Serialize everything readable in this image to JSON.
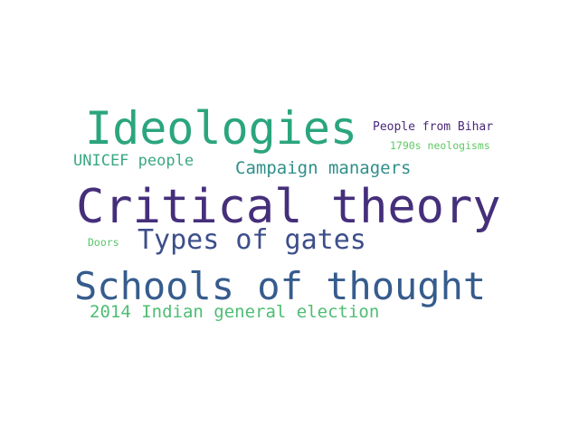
{
  "words": [
    {
      "text": "Critical theory",
      "color": "#452f7b"
    },
    {
      "text": "Ideologies",
      "color": "#2ba57e"
    },
    {
      "text": "Schools of thought",
      "color": "#365c8d"
    },
    {
      "text": "Types of gates",
      "color": "#3d4e8a"
    },
    {
      "text": "Campaign managers",
      "color": "#2f8f8a"
    },
    {
      "text": "UNICEF people",
      "color": "#3aa882"
    },
    {
      "text": "2014 Indian general election",
      "color": "#4fbd73"
    },
    {
      "text": "People from Bihar",
      "color": "#482878"
    },
    {
      "text": "1790s neologisms",
      "color": "#5ec962"
    },
    {
      "text": "Doors",
      "color": "#56c46a"
    }
  ]
}
